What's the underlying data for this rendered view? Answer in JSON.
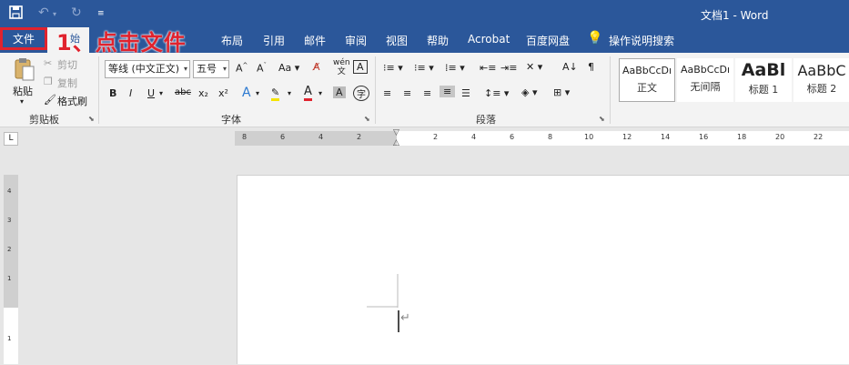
{
  "title_bar": {
    "document_title": "文档1 - Word"
  },
  "quick_access": {
    "save_icon": "save-icon",
    "undo_icon": "undo-icon",
    "redo_icon": "redo-icon",
    "customize_icon": "customize-qat-icon"
  },
  "tabs": {
    "file": "文件",
    "home_partial": "始",
    "items": [
      "布局",
      "引用",
      "邮件",
      "审阅",
      "视图",
      "帮助",
      "Acrobat",
      "百度网盘"
    ],
    "tell_me": "操作说明搜索"
  },
  "annotation": "1、点击文件",
  "clipboard": {
    "paste": "粘贴",
    "cut": "剪切",
    "copy": "复制",
    "format_painter": "格式刷",
    "group_label": "剪贴板"
  },
  "font": {
    "font_name": "等线 (中文正文)",
    "font_size": "五号",
    "group_label": "字体",
    "buttons": [
      "B",
      "I",
      "U",
      "abc",
      "x₂",
      "x²"
    ]
  },
  "paragraph": {
    "group_label": "段落"
  },
  "styles": [
    {
      "sample": "AaBbCcDı",
      "name": "正文"
    },
    {
      "sample": "AaBbCcDı",
      "name": "无间隔"
    },
    {
      "sample": "AaBl",
      "name": "标题 1"
    },
    {
      "sample": "AaBbC",
      "name": "标题 2"
    }
  ],
  "ruler": {
    "tab_selector": "L",
    "left_numbers": [
      "8",
      "6",
      "4",
      "2"
    ],
    "right_numbers": [
      "2",
      "4",
      "6",
      "8",
      "10",
      "12",
      "14",
      "16",
      "18",
      "20",
      "22"
    ],
    "vertical_numbers": [
      "4",
      "3",
      "2",
      "1",
      "1"
    ]
  },
  "document": {
    "paragraph_mark": "↵"
  },
  "colors": {
    "word_blue": "#2b579a",
    "annotation_red": "#e0232e"
  }
}
